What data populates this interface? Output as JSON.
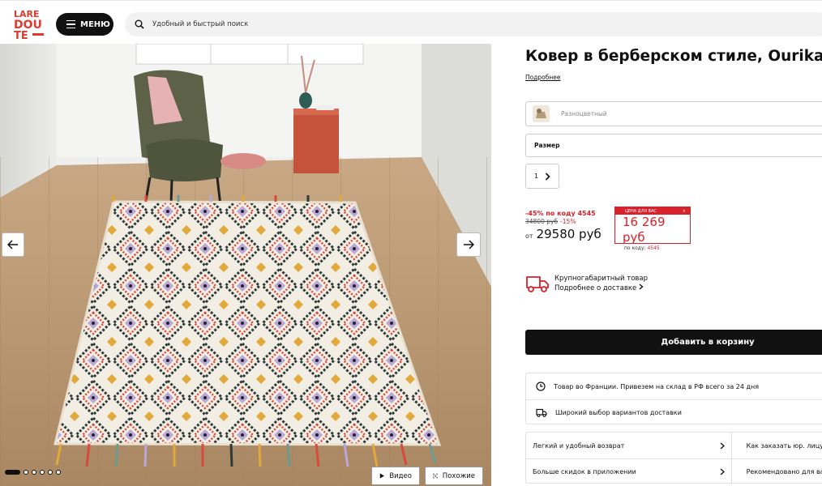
{
  "header": {
    "logo_text": "LA REDOUTE",
    "menu_label": "МЕНЮ",
    "search_placeholder": "Удобный и быстрый поиск"
  },
  "gallery": {
    "video_label": "Видео",
    "similar_label": "Похожие",
    "slides_total": 6,
    "slide_active": 1
  },
  "product": {
    "title": "Ковер в берберском стиле, Ourika",
    "more_link": "Подробнее",
    "color_label": "Разноцветный",
    "size_label": "Размер",
    "quantity": "1"
  },
  "pricing": {
    "promo_code_text": "-45% по коду 4545",
    "old_price": "34800 руб",
    "discount": "-15%",
    "from_label": "от",
    "from_price": "29580 руб",
    "promo_box_header": "ЦЕНА ДЛЯ ВАС",
    "promo_box_price": "16 269 руб",
    "promo_box_code_label": "по коду:",
    "promo_box_code": "4545"
  },
  "delivery": {
    "line1": "Крупногабаритный товар",
    "line2": "Подробнее о доставке"
  },
  "cart_button": "Добавить в корзину",
  "features": [
    "Товар во Франции. Привезем на склад в РФ всего за 24 дня",
    "Широкий выбор вариантов доставки"
  ],
  "links": [
    {
      "left": "Легкий и удобный возврат",
      "right": "Как заказать юр. лицу"
    },
    {
      "left": "Больше скидок в приложении",
      "right": "Рекомендовано для вас"
    }
  ],
  "colors": {
    "accent_red": "#d8212b",
    "dark": "#111111"
  }
}
